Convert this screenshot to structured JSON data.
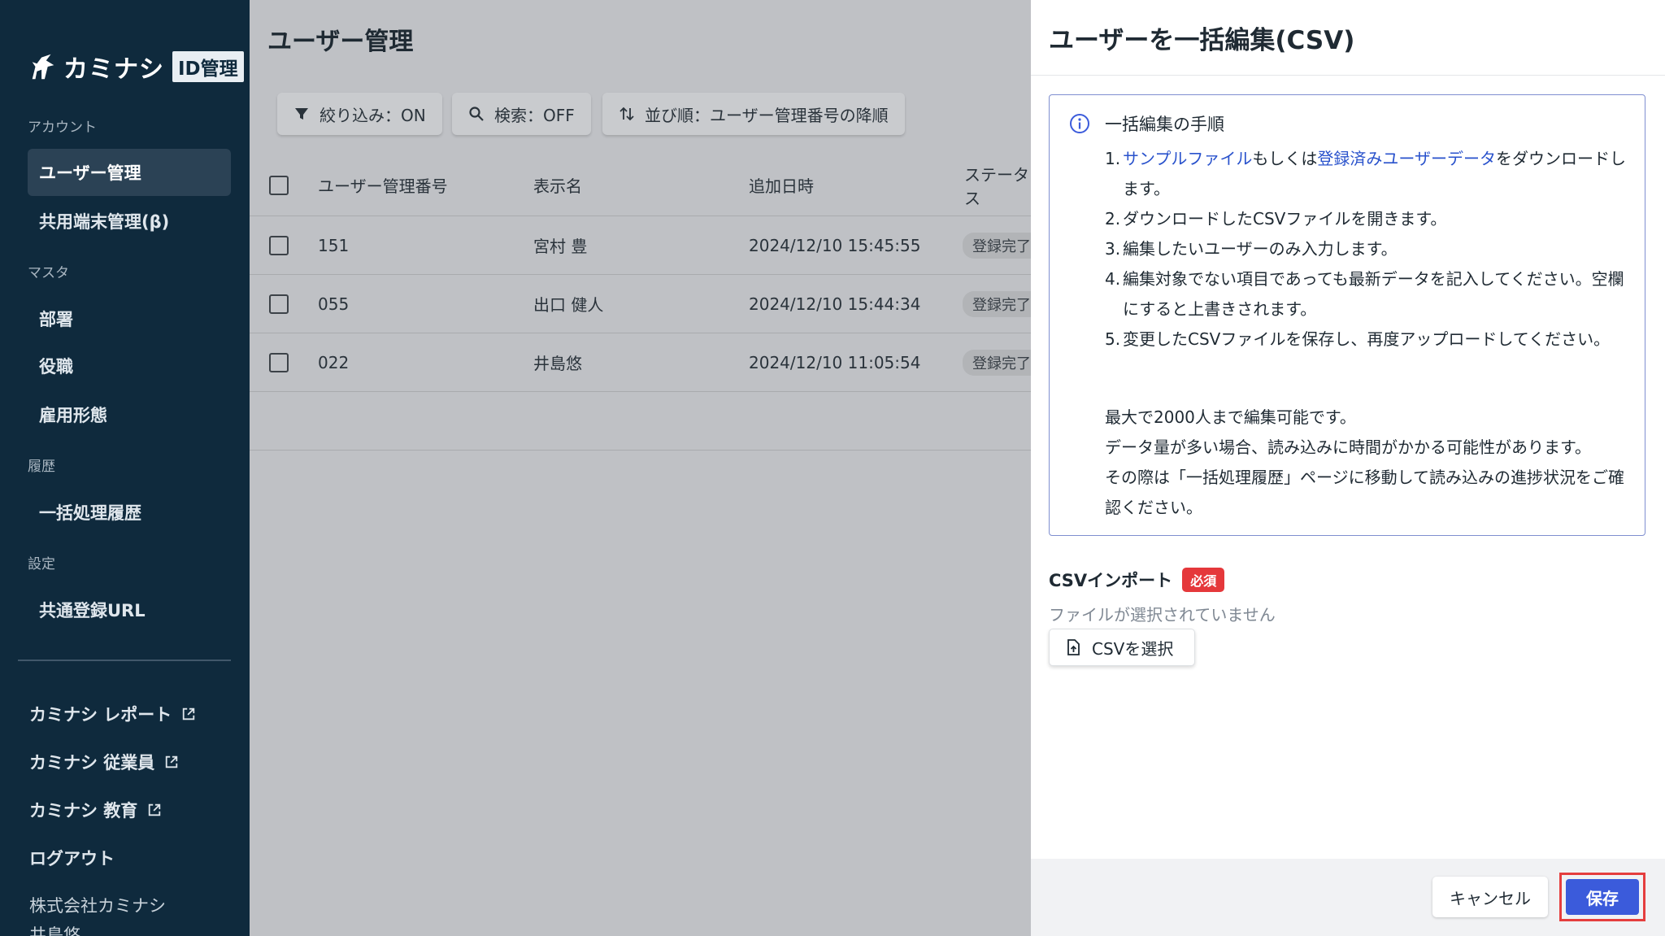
{
  "sidebar": {
    "logo_text": "カミナシ",
    "logo_badge": "ID管理",
    "sections": {
      "account": "アカウント",
      "master": "マスタ",
      "history": "履歴",
      "settings": "設定"
    },
    "items": {
      "users": "ユーザー管理",
      "shared_devices": "共用端末管理(β)",
      "departments": "部署",
      "positions": "役職",
      "employment": "雇用形態",
      "batch_history": "一括処理履歴",
      "common_url": "共通登録URL"
    },
    "links": {
      "report": "カミナシ レポート",
      "employee": "カミナシ 従業員",
      "education": "カミナシ 教育",
      "logout": "ログアウト"
    },
    "company": "株式会社カミナシ",
    "user_name_partial": "井島悠"
  },
  "main": {
    "title": "ユーザー管理",
    "toolbar": {
      "filter": "絞り込み：ON",
      "search": "検索：OFF",
      "sort": "並び順：ユーザー管理番号の降順"
    },
    "table": {
      "headers": {
        "id": "ユーザー管理番号",
        "name": "表示名",
        "added": "追加日時",
        "status": "ステータス"
      },
      "rows": [
        {
          "id": "151",
          "name": "宮村 豊",
          "added": "2024/12/10 15:45:55",
          "status": "登録完了"
        },
        {
          "id": "055",
          "name": "出口 健人",
          "added": "2024/12/10 15:44:34",
          "status": "登録完了"
        },
        {
          "id": "022",
          "name": "井島悠",
          "added": "2024/12/10 11:05:54",
          "status": "登録完了"
        }
      ]
    }
  },
  "panel": {
    "title": "ユーザーを一括編集(CSV)",
    "info": {
      "title": "一括編集の手順",
      "step1": {
        "num": "1.",
        "link1": "サンプルファイル",
        "mid": "もしくは",
        "link2": "登録済みユーザーデータ",
        "end": "をダウンロードします。"
      },
      "step2": {
        "num": "2.",
        "text": "ダウンロードしたCSVファイルを開きます。"
      },
      "step3": {
        "num": "3.",
        "text": "編集したいユーザーのみ入力します。"
      },
      "step4": {
        "num": "4.",
        "text": "編集対象でない項目であっても最新データを記入してください。空欄にすると上書きされます。"
      },
      "step5": {
        "num": "5.",
        "text": "変更したCSVファイルを保存し、再度アップロードしてください。"
      },
      "note1": "最大で2000人まで編集可能です。",
      "note2": "データ量が多い場合、読み込みに時間がかかる可能性があります。",
      "note3": "その際は「一括処理履歴」ページに移動して読み込みの進捗状況をご確認ください。"
    },
    "csv_import_label": "CSVインポート",
    "required_badge": "必須",
    "no_file": "ファイルが選択されていません",
    "select_csv": "CSVを選択",
    "cancel": "キャンセル",
    "save": "保存"
  },
  "colors": {
    "sidebar_bg": "#0f2a3d",
    "accent": "#3b5bdb",
    "link": "#2952cc",
    "required": "#e5383b",
    "highlight_outline": "#e53e3e"
  }
}
